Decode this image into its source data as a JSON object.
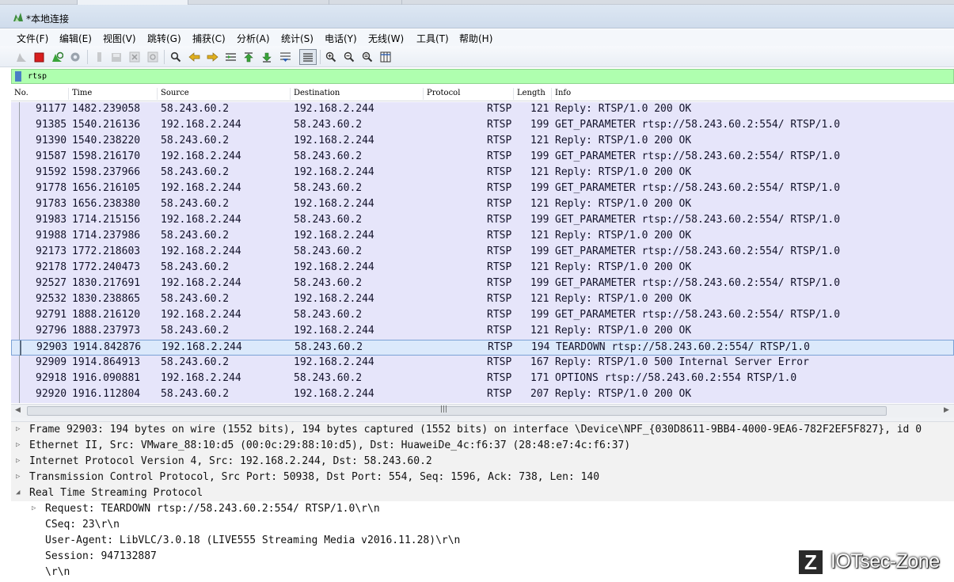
{
  "window": {
    "title": "*本地连接"
  },
  "menu": [
    "文件(F)",
    "编辑(E)",
    "视图(V)",
    "跳转(G)",
    "捕获(C)",
    "分析(A)",
    "统计(S)",
    "电话(Y)",
    "无线(W)",
    "工具(T)",
    "帮助(H)"
  ],
  "toolbar_icons": [
    "shark-start-icon-disabled",
    "stop-capture-icon",
    "restart-capture-icon",
    "capture-options-icon",
    "open-file-icon",
    "save-file-icon",
    "close-file-icon",
    "reload-file-icon",
    "find-packet-icon",
    "go-back-icon",
    "go-forward-icon",
    "go-to-packet-icon",
    "go-first-icon",
    "go-last-icon",
    "autoscroll-icon",
    "colorize-icon",
    "zoom-in-icon",
    "zoom-out-icon",
    "zoom-normal-icon",
    "resize-columns-icon"
  ],
  "filter": {
    "value": "rtsp"
  },
  "columns": [
    "No.",
    "Time",
    "Source",
    "Destination",
    "Protocol",
    "Length",
    "Info"
  ],
  "packets": [
    {
      "no": "91177",
      "time": "1482.239058",
      "src": "58.243.60.2",
      "dst": "192.168.2.244",
      "proto": "RTSP",
      "len": "121",
      "info": "Reply: RTSP/1.0 200 OK"
    },
    {
      "no": "91385",
      "time": "1540.216136",
      "src": "192.168.2.244",
      "dst": "58.243.60.2",
      "proto": "RTSP",
      "len": "199",
      "info": "GET_PARAMETER rtsp://58.243.60.2:554/ RTSP/1.0"
    },
    {
      "no": "91390",
      "time": "1540.238220",
      "src": "58.243.60.2",
      "dst": "192.168.2.244",
      "proto": "RTSP",
      "len": "121",
      "info": "Reply: RTSP/1.0 200 OK"
    },
    {
      "no": "91587",
      "time": "1598.216170",
      "src": "192.168.2.244",
      "dst": "58.243.60.2",
      "proto": "RTSP",
      "len": "199",
      "info": "GET_PARAMETER rtsp://58.243.60.2:554/ RTSP/1.0"
    },
    {
      "no": "91592",
      "time": "1598.237966",
      "src": "58.243.60.2",
      "dst": "192.168.2.244",
      "proto": "RTSP",
      "len": "121",
      "info": "Reply: RTSP/1.0 200 OK"
    },
    {
      "no": "91778",
      "time": "1656.216105",
      "src": "192.168.2.244",
      "dst": "58.243.60.2",
      "proto": "RTSP",
      "len": "199",
      "info": "GET_PARAMETER rtsp://58.243.60.2:554/ RTSP/1.0"
    },
    {
      "no": "91783",
      "time": "1656.238380",
      "src": "58.243.60.2",
      "dst": "192.168.2.244",
      "proto": "RTSP",
      "len": "121",
      "info": "Reply: RTSP/1.0 200 OK"
    },
    {
      "no": "91983",
      "time": "1714.215156",
      "src": "192.168.2.244",
      "dst": "58.243.60.2",
      "proto": "RTSP",
      "len": "199",
      "info": "GET_PARAMETER rtsp://58.243.60.2:554/ RTSP/1.0"
    },
    {
      "no": "91988",
      "time": "1714.237986",
      "src": "58.243.60.2",
      "dst": "192.168.2.244",
      "proto": "RTSP",
      "len": "121",
      "info": "Reply: RTSP/1.0 200 OK"
    },
    {
      "no": "92173",
      "time": "1772.218603",
      "src": "192.168.2.244",
      "dst": "58.243.60.2",
      "proto": "RTSP",
      "len": "199",
      "info": "GET_PARAMETER rtsp://58.243.60.2:554/ RTSP/1.0"
    },
    {
      "no": "92178",
      "time": "1772.240473",
      "src": "58.243.60.2",
      "dst": "192.168.2.244",
      "proto": "RTSP",
      "len": "121",
      "info": "Reply: RTSP/1.0 200 OK"
    },
    {
      "no": "92527",
      "time": "1830.217691",
      "src": "192.168.2.244",
      "dst": "58.243.60.2",
      "proto": "RTSP",
      "len": "199",
      "info": "GET_PARAMETER rtsp://58.243.60.2:554/ RTSP/1.0"
    },
    {
      "no": "92532",
      "time": "1830.238865",
      "src": "58.243.60.2",
      "dst": "192.168.2.244",
      "proto": "RTSP",
      "len": "121",
      "info": "Reply: RTSP/1.0 200 OK"
    },
    {
      "no": "92791",
      "time": "1888.216120",
      "src": "192.168.2.244",
      "dst": "58.243.60.2",
      "proto": "RTSP",
      "len": "199",
      "info": "GET_PARAMETER rtsp://58.243.60.2:554/ RTSP/1.0"
    },
    {
      "no": "92796",
      "time": "1888.237973",
      "src": "58.243.60.2",
      "dst": "192.168.2.244",
      "proto": "RTSP",
      "len": "121",
      "info": "Reply: RTSP/1.0 200 OK"
    },
    {
      "no": "92903",
      "time": "1914.842876",
      "src": "192.168.2.244",
      "dst": "58.243.60.2",
      "proto": "RTSP",
      "len": "194",
      "info": "TEARDOWN rtsp://58.243.60.2:554/ RTSP/1.0",
      "selected": true
    },
    {
      "no": "92909",
      "time": "1914.864913",
      "src": "58.243.60.2",
      "dst": "192.168.2.244",
      "proto": "RTSP",
      "len": "167",
      "info": "Reply: RTSP/1.0 500 Internal Server Error"
    },
    {
      "no": "92918",
      "time": "1916.090881",
      "src": "192.168.2.244",
      "dst": "58.243.60.2",
      "proto": "RTSP",
      "len": "171",
      "info": "OPTIONS rtsp://58.243.60.2:554 RTSP/1.0"
    },
    {
      "no": "92920",
      "time": "1916.112804",
      "src": "58.243.60.2",
      "dst": "192.168.2.244",
      "proto": "RTSP",
      "len": "207",
      "info": "Reply: RTSP/1.0 200 OK"
    }
  ],
  "details": [
    {
      "expander": "collapsed",
      "text": "Frame 92903: 194 bytes on wire (1552 bits), 194 bytes captured (1552 bits) on interface \\Device\\NPF_{030D8611-9BB4-4000-9EA6-782F2EF5F827}, id 0"
    },
    {
      "expander": "collapsed",
      "text": "Ethernet II, Src: VMware_88:10:d5 (00:0c:29:88:10:d5), Dst: HuaweiDe_4c:f6:37 (28:48:e7:4c:f6:37)"
    },
    {
      "expander": "collapsed",
      "text": "Internet Protocol Version 4, Src: 192.168.2.244, Dst: 58.243.60.2"
    },
    {
      "expander": "collapsed",
      "text": "Transmission Control Protocol, Src Port: 50938, Dst Port: 554, Seq: 1596, Ack: 738, Len: 140"
    },
    {
      "expander": "expanded",
      "text": "Real Time Streaming Protocol"
    },
    {
      "expander": "collapsed",
      "text": "Request: TEARDOWN rtsp://58.243.60.2:554/ RTSP/1.0\\r\\n",
      "indent": true
    },
    {
      "expander": "none",
      "text": "CSeq: 23\\r\\n",
      "indent": true
    },
    {
      "expander": "none",
      "text": "User-Agent: LibVLC/3.0.18 (LIVE555 Streaming Media v2016.11.28)\\r\\n",
      "indent": true
    },
    {
      "expander": "none",
      "text": "Session: 947132887",
      "indent": true
    },
    {
      "expander": "none",
      "text": "\\r\\n",
      "indent": true
    }
  ],
  "watermark": {
    "logo_letter": "Z",
    "text": "IOTsec-Zone"
  },
  "colors": {
    "rtsp_row": "#e6e5fa",
    "filter_ok": "#afffaf",
    "selected": "#dbe9fb"
  }
}
